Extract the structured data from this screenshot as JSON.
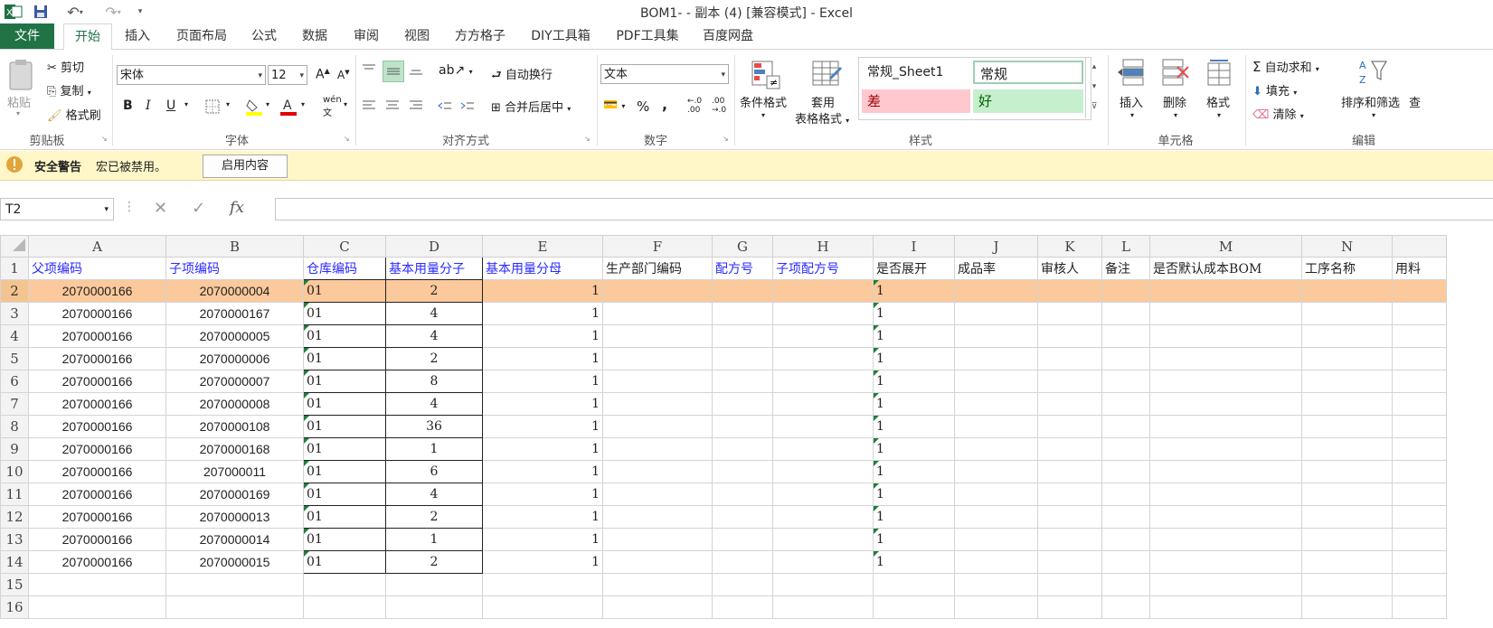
{
  "window": {
    "title": "BOM1- - 副本 (4)  [兼容模式] - Excel"
  },
  "tabs": [
    "文件",
    "开始",
    "插入",
    "页面布局",
    "公式",
    "数据",
    "审阅",
    "视图",
    "方方格子",
    "DIY工具箱",
    "PDF工具集",
    "百度网盘"
  ],
  "ribbon": {
    "clipboard": {
      "paste": "粘贴",
      "cut": "剪切",
      "copy": "复制",
      "format_painter": "格式刷",
      "label": "剪贴板"
    },
    "font": {
      "name": "宋体",
      "size": "12",
      "label": "字体",
      "bold": "B",
      "italic": "I",
      "underline": "U",
      "phonetic": "wén"
    },
    "alignment": {
      "wrap": "自动换行",
      "merge": "合并后居中",
      "label": "对齐方式"
    },
    "number": {
      "format": "文本",
      "percent": "%",
      "comma": ",",
      "label": "数字",
      "inc_dec": ".0 .00",
      "dec_dec": ".00 .0"
    },
    "styles": {
      "conditional": "条件格式",
      "table_line1": "套用",
      "table_line2": "表格格式",
      "normal_sheet": "常规_Sheet1",
      "normal": "常规",
      "bad": "差",
      "good": "好",
      "label": "样式"
    },
    "cells": {
      "insert": "插入",
      "delete": "删除",
      "format": "格式",
      "label": "单元格"
    },
    "editing": {
      "autosum": "自动求和",
      "fill": "填充",
      "clear": "清除",
      "sort": "排序和筛选",
      "find": "查",
      "label": "编辑"
    }
  },
  "security": {
    "title": "安全警告",
    "message": "宏已被禁用。",
    "button": "启用内容"
  },
  "formula_bar": {
    "name_box": "T2",
    "fx": "fx",
    "value": ""
  },
  "colors": {
    "accent": "#217346",
    "selection": "#fbc99b",
    "header_blue": "#2a2aff",
    "warning_bg": "#fff7c8"
  },
  "columns": [
    "A",
    "B",
    "C",
    "D",
    "E",
    "F",
    "G",
    "H",
    "I",
    "J",
    "K",
    "L",
    "M",
    "N"
  ],
  "headers": [
    "父项编码",
    "子项编码",
    "仓库编码",
    "基本用量分子",
    "基本用量分母",
    "生产部门编码",
    "配方号",
    "子项配方号",
    "是否展开",
    "成品率",
    "审核人",
    "备注",
    "是否默认成本BOM",
    "工序名称",
    "用料"
  ],
  "rows": [
    [
      "2070000166",
      "2070000004",
      "01",
      "2",
      "1",
      "1"
    ],
    [
      "2070000166",
      "2070000167",
      "01",
      "4",
      "1",
      "1"
    ],
    [
      "2070000166",
      "2070000005",
      "01",
      "4",
      "1",
      "1"
    ],
    [
      "2070000166",
      "2070000006",
      "01",
      "2",
      "1",
      "1"
    ],
    [
      "2070000166",
      "2070000007",
      "01",
      "8",
      "1",
      "1"
    ],
    [
      "2070000166",
      "2070000008",
      "01",
      "4",
      "1",
      "1"
    ],
    [
      "2070000166",
      "2070000108",
      "01",
      "36",
      "1",
      "1"
    ],
    [
      "2070000166",
      "2070000168",
      "01",
      "1",
      "1",
      "1"
    ],
    [
      "2070000166",
      "207000011",
      "01",
      "6",
      "1",
      "1"
    ],
    [
      "2070000166",
      "2070000169",
      "01",
      "4",
      "1",
      "1"
    ],
    [
      "2070000166",
      "2070000013",
      "01",
      "2",
      "1",
      "1"
    ],
    [
      "2070000166",
      "2070000014",
      "01",
      "1",
      "1",
      "1"
    ],
    [
      "2070000166",
      "2070000015",
      "01",
      "2",
      "1",
      "1"
    ]
  ],
  "row_numbers": [
    "1",
    "2",
    "3",
    "4",
    "5",
    "6",
    "7",
    "8",
    "9",
    "10",
    "11",
    "12",
    "13",
    "14",
    "15",
    "16"
  ]
}
